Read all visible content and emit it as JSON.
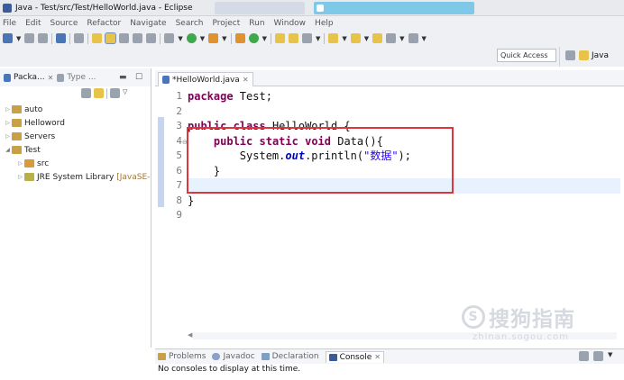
{
  "window": {
    "title": "Java - Test/src/Test/HelloWorld.java - Eclipse"
  },
  "menu": [
    "File",
    "Edit",
    "Source",
    "Refactor",
    "Navigate",
    "Search",
    "Project",
    "Run",
    "Window",
    "Help"
  ],
  "toolbar": {
    "quick_access": "Quick Access",
    "perspective_java": "Java"
  },
  "package_explorer": {
    "tab_label": "Packa...",
    "type_tab_label": "Type ...",
    "tree": [
      {
        "label": "auto",
        "expanded": false,
        "depth": 0,
        "icon": "project-icon"
      },
      {
        "label": "Helloword",
        "expanded": false,
        "depth": 0,
        "icon": "project-icon"
      },
      {
        "label": "Servers",
        "expanded": false,
        "depth": 0,
        "icon": "folder-icon"
      },
      {
        "label": "Test",
        "expanded": true,
        "depth": 0,
        "icon": "project-icon"
      },
      {
        "label": "src",
        "expanded": false,
        "depth": 1,
        "icon": "source-folder-icon"
      },
      {
        "label": "JRE System Library",
        "suffix": "[JavaSE-",
        "expanded": false,
        "depth": 1,
        "icon": "library-icon"
      }
    ]
  },
  "editor": {
    "tab_label": "*HelloWorld.java",
    "line_numbers": [
      "1",
      "2",
      "3",
      "4",
      "5",
      "6",
      "7",
      "8",
      "9"
    ],
    "code": {
      "l1_kw": "package",
      "l1_rest": " Test;",
      "l3_kw1": "public",
      "l3_kw2": "class",
      "l3_rest": " HelloWorld {",
      "l4_indent": "    ",
      "l4_kw1": "public",
      "l4_kw2": "static",
      "l4_kw3": "void",
      "l4_rest": " Data(){",
      "l5_pre": "        System.",
      "l5_field": "out",
      "l5_mid": ".println(",
      "l5_str": "\"数据\"",
      "l5_end": ");",
      "l6": "    }",
      "l8": "}"
    }
  },
  "bottom_panel": {
    "tabs": [
      "Problems",
      "Javadoc",
      "Declaration",
      "Console"
    ],
    "active_tab": "Console",
    "message": "No consoles to display at this time."
  },
  "watermark": {
    "circle_char": "S",
    "main": "搜狗指南",
    "sub": "zhinan.sogou.com"
  },
  "colors": {
    "keyword": "#7f0055",
    "string": "#2a00ff",
    "static_field": "#0000c0",
    "highlight_box": "#e0353c",
    "current_line": "#e8f2fe"
  }
}
